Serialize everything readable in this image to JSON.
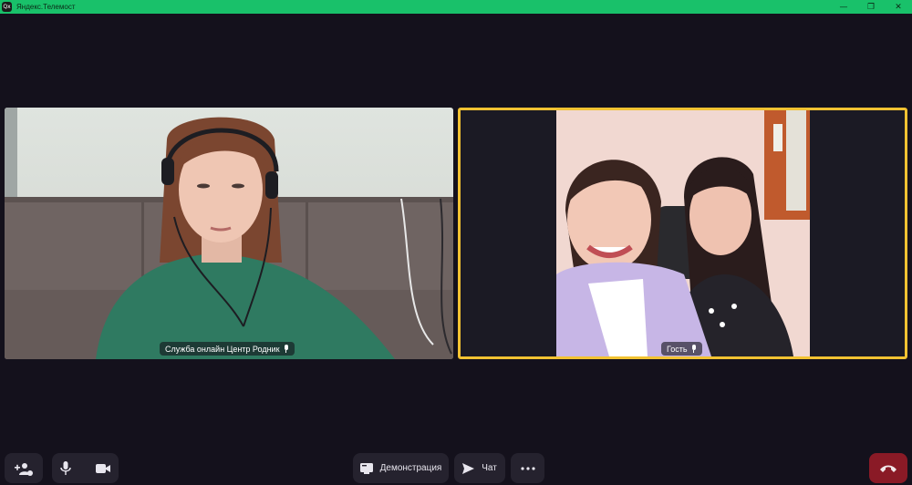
{
  "window": {
    "icon_text": "Qx",
    "title": "Яндекс.Телемост",
    "controls": [
      "—",
      "❐",
      "✕"
    ]
  },
  "participants": [
    {
      "name": "Служба онлайн Центр Родник",
      "mic_on": true,
      "active_speaker": false
    },
    {
      "name": "Гость",
      "mic_on": true,
      "active_speaker": true
    }
  ],
  "toolbar": {
    "add_participant_icon": "add-person-icon",
    "mic_icon": "microphone-icon",
    "camera_icon": "camera-icon",
    "screen_share_label": "Демонстрация",
    "chat_label": "Чат",
    "more_icon": "more-icon",
    "hangup_icon": "phone-hangup-icon"
  },
  "colors": {
    "titlebar": "#19c16a",
    "background": "#14111c",
    "active_border": "#f2c232",
    "hangup": "#8a1a26",
    "button_bg": "#25222e"
  }
}
